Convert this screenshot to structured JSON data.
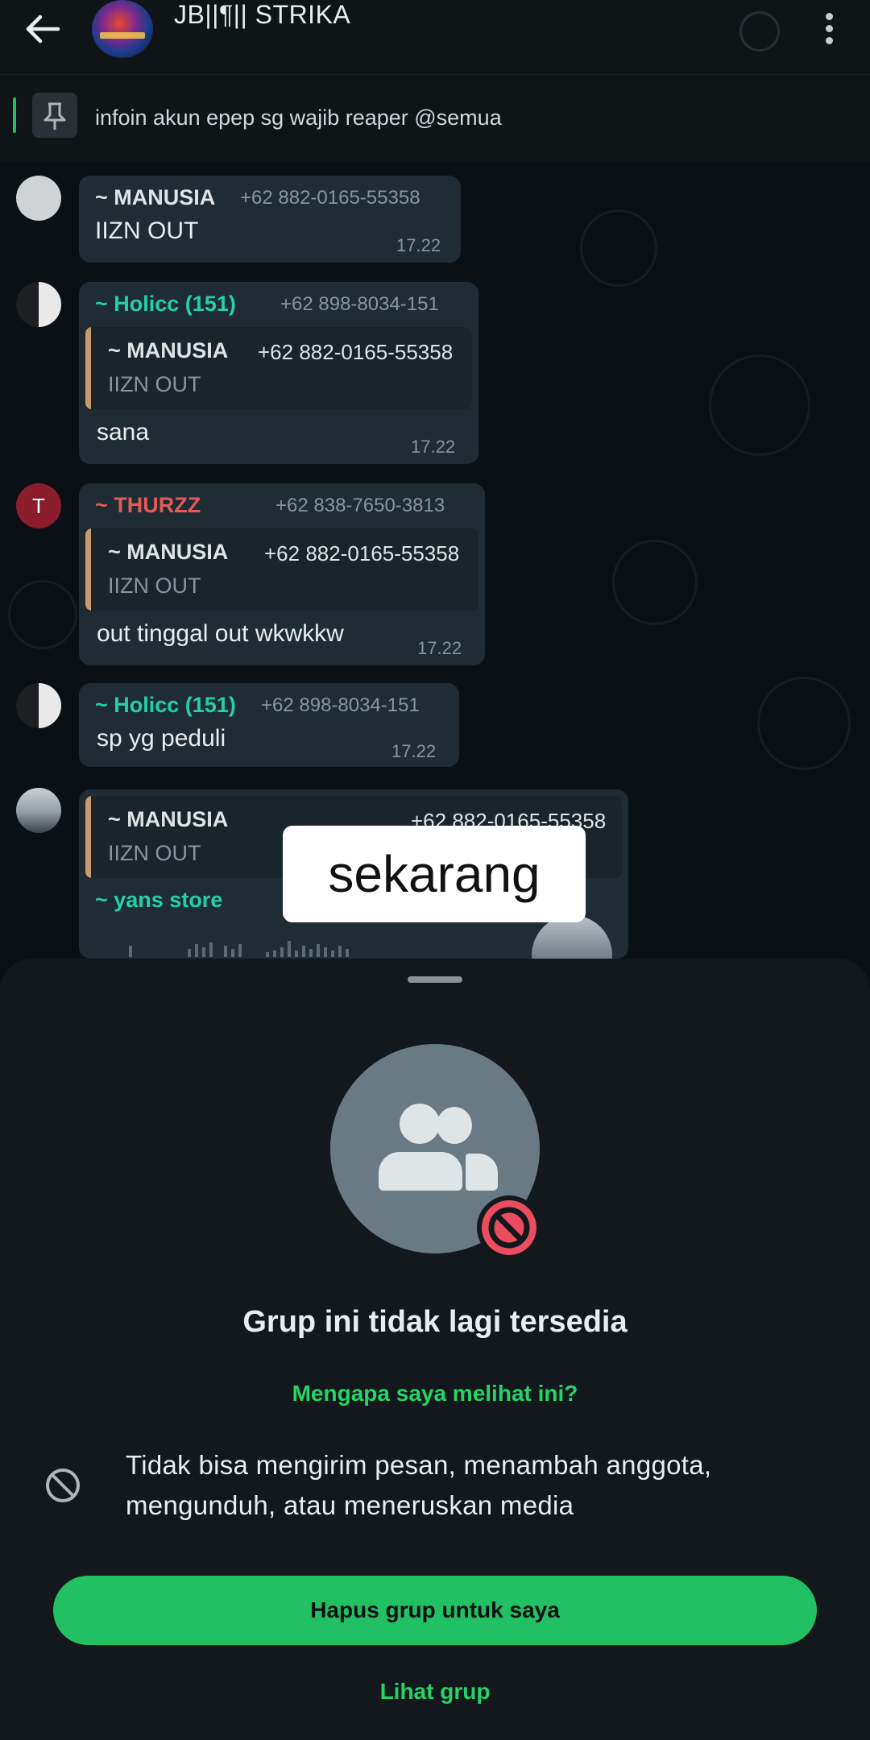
{
  "header": {
    "title": "JB||¶|| STRIKA",
    "back_icon": "arrow-left-icon",
    "more_icon": "more-vertical-icon"
  },
  "pinned": {
    "icon": "pin-icon",
    "text": "infoin akun epep sg wajib reaper @semua"
  },
  "messages": [
    {
      "sender": "~ MANUSIA",
      "phone": "+62 882-0165-55358",
      "text": "IIZN OUT",
      "time": "17.22"
    },
    {
      "sender": "~ Holicc (151)",
      "phone": "+62 898-8034-151",
      "quote": {
        "sender": "~ MANUSIA",
        "phone": "+62 882-0165-55358",
        "text": "IIZN OUT"
      },
      "text": "sana",
      "time": "17.22"
    },
    {
      "sender": "~ THURZZ",
      "avatar_letter": "T",
      "phone": "+62 838-7650-3813",
      "quote": {
        "sender": "~ MANUSIA",
        "phone": "+62 882-0165-55358",
        "text": "IIZN OUT"
      },
      "text": "out tinggal out wkwkkw",
      "time": "17.22"
    },
    {
      "sender": "~ Holicc (151)",
      "phone": "+62 898-8034-151",
      "text": "sp yg peduli",
      "time": "17.22"
    },
    {
      "quote": {
        "sender": "~ MANUSIA",
        "phone": "+62 882-0165-55358",
        "text": "IIZN OUT"
      },
      "sender": "~ yans store"
    }
  ],
  "overlay_caption": "sekarang",
  "sheet": {
    "title": "Grup ini tidak lagi tersedia",
    "why_link": "Mengapa saya melihat ini?",
    "info_text": "Tidak bisa mengirim pesan, menambah anggota, mengunduh, atau meneruskan media",
    "delete_button": "Hapus grup untuk saya",
    "view_link": "Lihat grup"
  },
  "colors": {
    "accent_green": "#21c063",
    "teal_sender": "#25d0a6",
    "red_sender": "#e25a5a",
    "bubble": "#1f2c33",
    "background": "#0b1014"
  }
}
